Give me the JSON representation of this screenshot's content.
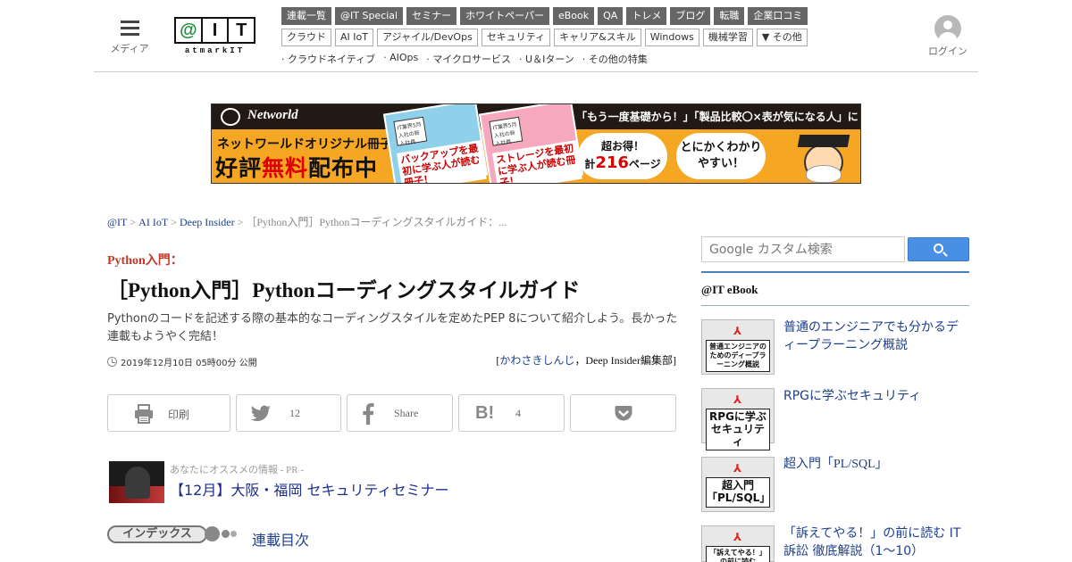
{
  "header": {
    "menu_label": "メディア",
    "logo": {
      "chars": [
        "@",
        "I",
        "T"
      ],
      "word": "atmarkIT"
    },
    "nav_primary": [
      "連載一覧",
      "@IT Special",
      "セミナー",
      "ホワイトペーパー",
      "eBook",
      "QA",
      "トレメ",
      "ブログ",
      "転職",
      "企業口コミ"
    ],
    "nav_secondary": [
      "クラウド",
      "AI IoT",
      "アジャイル/DevOps",
      "セキュリティ",
      "キャリア&スキル",
      "Windows",
      "機械学習",
      "▼ その他"
    ],
    "nav_tertiary": [
      "クラウドネイティブ",
      "AIOps",
      "マイクロサービス",
      "U＆Iターン",
      "その他の特集"
    ],
    "login_label": "ログイン"
  },
  "banner": {
    "brand": "Networld",
    "line1": "ネットワールドオリジナル冊子",
    "line2_a": "好評",
    "line2_red": "無料",
    "line2_b": "配布中",
    "book1_title": "バックアップを最初に学ぶ人が読む冊子！",
    "book2_title": "ストレージを最初に学ぶ人が読む冊子！",
    "book_head": "IT業界5月入社の新入社員",
    "right_head": "「もう一度基礎から！」「製品比較〇×表が気になる人」に",
    "bubble1_a": "超お得！",
    "bubble1_b": "計",
    "bubble1_num": "216",
    "bubble1_c": "ページ",
    "bubble2": "とにかくわかりやすい！"
  },
  "breadcrumb": {
    "items": [
      "@IT",
      "AI IoT",
      "Deep Insider"
    ],
    "sep": ">",
    "current": "［Python入門］Pythonコーディングスタイルガイド：..."
  },
  "article": {
    "kicker": "Python入門：",
    "title": "［Python入門］Pythonコーディングスタイルガイド",
    "lead": "Pythonのコードを記述する際の基本的なコーディングスタイルを定めたPEP 8について紹介しよう。長かった連載もようやく完結！",
    "date": "2019年12月10日 05時00分 公開",
    "author_open": "[",
    "author_link": "かわさきしんじ",
    "author_rest": "，Deep Insider編集部]"
  },
  "share": {
    "print": "印刷",
    "twitter": "12",
    "facebook": "Share",
    "hatena": "4",
    "hatena_glyph": "B!"
  },
  "ad": {
    "label": "あなたにオススメの情報 - PR -",
    "link": "【12月】大阪・福岡 セキュリティセミナー"
  },
  "index": {
    "badge": "インデックス",
    "link": "連載目次"
  },
  "sidebar": {
    "search_placeholder": "Google カスタム検索",
    "ebook_heading": "@IT eBook",
    "pdf_glyph": "⅄",
    "ebooks": [
      {
        "thumb": "普通エンジニアのためのディープラーニング概説",
        "title": "普通のエンジニアでも分かるディープラーニング概説"
      },
      {
        "thumb": "RPGに学ぶセキュリティ",
        "title": "RPGに学ぶセキュリティ"
      },
      {
        "thumb": "超入門「PL/SQL」",
        "title": "超入門「PL/SQL」"
      },
      {
        "thumb": "「訴えてやる！」の前に読む",
        "title": "「訴えてやる！」の前に読む IT訴訟 徹底解説（1～10）"
      }
    ]
  }
}
